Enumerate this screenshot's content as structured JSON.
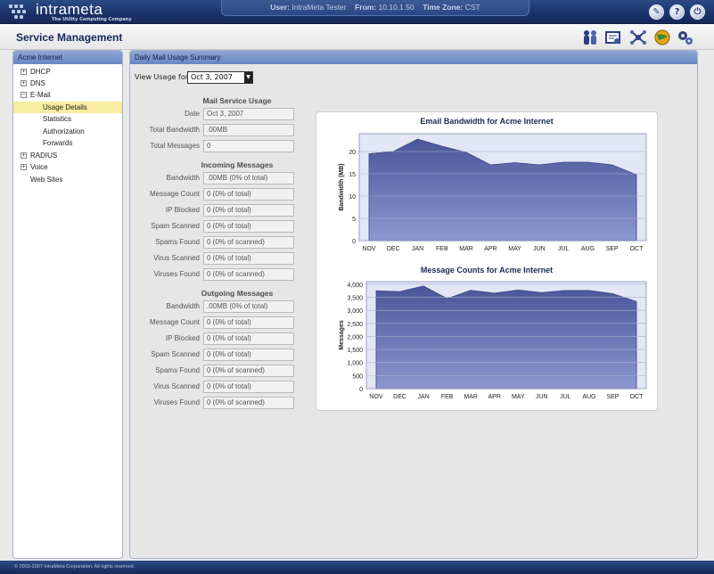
{
  "brand": {
    "name": "intrameta",
    "tagline": "The Utility Computing Company"
  },
  "session": {
    "user_label": "User:",
    "user": "IntraMeta Tester",
    "from_label": "From:",
    "from": "10.10.1.50",
    "tz_label": "Time Zone:",
    "tz": "CST"
  },
  "header": {
    "title": "Service Management",
    "icons": [
      "users-icon",
      "certificate-icon",
      "network-icon",
      "globe-icon",
      "gears-icon"
    ]
  },
  "top_icons": [
    "tools-icon",
    "help-icon",
    "power-icon"
  ],
  "sidebar": {
    "title": "Acme Internet",
    "items": [
      {
        "label": "DHCP",
        "toggle": "+"
      },
      {
        "label": "DNS",
        "toggle": "+"
      },
      {
        "label": "E-Mail",
        "toggle": "−"
      },
      {
        "label": "Usage Details"
      },
      {
        "label": "Statistics"
      },
      {
        "label": "Authorization"
      },
      {
        "label": "Forwards"
      },
      {
        "label": "RADIUS",
        "toggle": "+"
      },
      {
        "label": "Voice",
        "toggle": "+"
      },
      {
        "label": "Web Sites"
      }
    ]
  },
  "main": {
    "title": "Daily Mail Usage Summary",
    "view_usage_label": "View Usage for:",
    "view_usage_value": "Oct 3, 2007",
    "sections": [
      {
        "heading": "Mail Service Usage",
        "rows": [
          {
            "label": "Date",
            "value": "Oct 3, 2007"
          },
          {
            "label": "Total Bandwidth",
            "value": ".00MB"
          },
          {
            "label": "Total Messages",
            "value": "0"
          }
        ]
      },
      {
        "heading": "Incoming Messages",
        "rows": [
          {
            "label": "Bandwidth",
            "value": ".00MB (0% of total)"
          },
          {
            "label": "Message Count",
            "value": "0 (0% of total)"
          },
          {
            "label": "IP Blocked",
            "value": "0 (0% of total)"
          },
          {
            "label": "Spam Scanned",
            "value": "0 (0% of total)"
          },
          {
            "label": "Spams Found",
            "value": "0 (0% of scanned)"
          },
          {
            "label": "Virus Scanned",
            "value": "0 (0% of total)"
          },
          {
            "label": "Viruses Found",
            "value": "0 (0% of scanned)"
          }
        ]
      },
      {
        "heading": "Outgoing Messages",
        "rows": [
          {
            "label": "Bandwidth",
            "value": ".00MB (0% of total)"
          },
          {
            "label": "Message Count",
            "value": "0 (0% of total)"
          },
          {
            "label": "IP Blocked",
            "value": "0 (0% of total)"
          },
          {
            "label": "Spam Scanned",
            "value": "0 (0% of total)"
          },
          {
            "label": "Spams Found",
            "value": "0 (0% of scanned)"
          },
          {
            "label": "Virus Scanned",
            "value": "0 (0% of total)"
          },
          {
            "label": "Viruses Found",
            "value": "0 (0% of scanned)"
          }
        ]
      }
    ]
  },
  "chart_data": [
    {
      "type": "area",
      "title": "Email Bandwidth for Acme Internet",
      "xlabel": "",
      "ylabel": "Bandwidth (MB)",
      "categories": [
        "NOV",
        "DEC",
        "JAN",
        "FEB",
        "MAR",
        "APR",
        "MAY",
        "JUN",
        "JUL",
        "AUG",
        "SEP",
        "OCT"
      ],
      "values": [
        19.5,
        20.0,
        22.8,
        21.2,
        19.8,
        17.0,
        17.5,
        17.0,
        17.6,
        17.6,
        17.0,
        14.8
      ],
      "ylim": [
        0,
        24
      ],
      "yticks": [
        "0",
        "5",
        "10",
        "15",
        "20"
      ],
      "grid": true,
      "fill_color": "#5b6aab"
    },
    {
      "type": "area",
      "title": "Message Counts for Acme Internet",
      "xlabel": "",
      "ylabel": "Messages",
      "categories": [
        "NOV",
        "DEC",
        "JAN",
        "FEB",
        "MAR",
        "APR",
        "MAY",
        "JUN",
        "JUL",
        "AUG",
        "SEP",
        "OCT"
      ],
      "values": [
        3750,
        3720,
        3930,
        3450,
        3770,
        3660,
        3780,
        3680,
        3760,
        3760,
        3640,
        3340
      ],
      "ylim": [
        0,
        4100
      ],
      "yticks": [
        "0",
        "500",
        "1,000",
        "1,500",
        "2,000",
        "2,500",
        "3,000",
        "3,500",
        "4,000"
      ],
      "grid": true,
      "fill_color": "#5b6aab"
    }
  ],
  "footer": {
    "text": "© 2003-2007 IntraMeta Corporation.  All rights reserved."
  }
}
